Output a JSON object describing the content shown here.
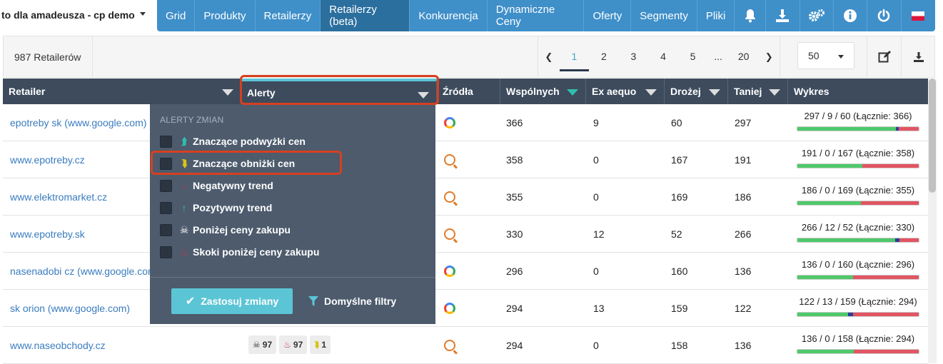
{
  "project": {
    "name": "to dla amadeusza - cp demo"
  },
  "nav": {
    "items": [
      "Grid",
      "Produkty",
      "Retailerzy",
      "Retailerzy (beta)",
      "Konkurencja",
      "Dynamiczne Ceny",
      "Oferty",
      "Segmenty",
      "Pliki"
    ],
    "active": "Retailerzy (beta)"
  },
  "toolbar": {
    "count_label": "987 Retailerów",
    "pages": [
      "1",
      "2",
      "3",
      "4",
      "5",
      "...",
      "20"
    ],
    "current_page": "1",
    "per_page": "50"
  },
  "table": {
    "headers": {
      "retailer": "Retailer",
      "alerty": "Alerty",
      "zrodla": "Źródła",
      "wspolnych": "Wspólnych",
      "ex_aequo": "Ex aequo",
      "drozej": "Drożej",
      "taniej": "Taniej",
      "wykres": "Wykres"
    },
    "rows": [
      {
        "retailer": "epotreby sk (www.google.com)",
        "source": "google",
        "wspolnych": "366",
        "ex_aequo": "9",
        "drozej": "60",
        "taniej": "297",
        "chart_label": "297 / 9 / 60 (Łącznie: 366)",
        "g": 297,
        "b": 9,
        "r": 60
      },
      {
        "retailer": "www.epotreby.cz",
        "source": "ceneo",
        "wspolnych": "358",
        "ex_aequo": "0",
        "drozej": "167",
        "taniej": "191",
        "chart_label": "191 / 0 / 167 (Łącznie: 358)",
        "g": 191,
        "b": 0,
        "r": 167
      },
      {
        "retailer": "www.elektromarket.cz",
        "source": "ceneo",
        "wspolnych": "355",
        "ex_aequo": "0",
        "drozej": "169",
        "taniej": "186",
        "chart_label": "186 / 0 / 169 (Łącznie: 355)",
        "g": 186,
        "b": 0,
        "r": 169
      },
      {
        "retailer": "www.epotreby.sk",
        "source": "ceneo",
        "wspolnych": "330",
        "ex_aequo": "12",
        "drozej": "52",
        "taniej": "266",
        "chart_label": "266 / 12 / 52 (Łącznie: 330)",
        "g": 266,
        "b": 12,
        "r": 52
      },
      {
        "retailer": "nasenadobi cz (www.google.com)",
        "source": "google",
        "wspolnych": "296",
        "ex_aequo": "0",
        "drozej": "160",
        "taniej": "136",
        "chart_label": "136 / 0 / 160 (Łącznie: 296)",
        "g": 136,
        "b": 0,
        "r": 160
      },
      {
        "retailer": "sk orion (www.google.com)",
        "source": "google",
        "wspolnych": "294",
        "ex_aequo": "13",
        "drozej": "159",
        "taniej": "122",
        "chart_label": "122 / 13 / 159 (Łącznie: 294)",
        "g": 122,
        "b": 13,
        "r": 159
      },
      {
        "retailer": "www.naseobchody.cz",
        "source": "ceneo",
        "wspolnych": "294",
        "ex_aequo": "0",
        "drozej": "158",
        "taniej": "136",
        "chart_label": "136 / 0 / 158 (Łącznie: 294)",
        "g": 136,
        "b": 0,
        "r": 158,
        "badges": [
          "97",
          "97",
          "1"
        ]
      }
    ]
  },
  "dropdown": {
    "header": "ALERTY ZMIAN",
    "options": [
      {
        "label": "Znaczące podwyżki cen",
        "icon": "trend-up-icon",
        "symbol": "⮭",
        "color": "#2fbfae"
      },
      {
        "label": "Znaczące obniżki cen",
        "icon": "trend-down-icon",
        "symbol": "⮯",
        "color": "#d6c21a"
      },
      {
        "label": "Negatywny trend",
        "icon": "arrow-down-icon",
        "symbol": "↓",
        "color": "#c8324a"
      },
      {
        "label": "Pozytywny trend",
        "icon": "arrow-up-icon",
        "symbol": "↑",
        "color": "#2fbfae"
      },
      {
        "label": "Poniżej ceny zakupu",
        "icon": "skull-icon",
        "symbol": "☠",
        "color": "#ffffff"
      },
      {
        "label": "Skoki poniżej ceny zakupu",
        "icon": "fire-icon",
        "symbol": "♨",
        "color": "#c8324a"
      }
    ],
    "apply_label": "Zastosuj zmiany",
    "defaults_label": "Domyślne filtry"
  },
  "colors": {
    "nav": "#3f8fc9",
    "header": "#3d4b5d",
    "highlight": "#d7401f",
    "green": "#4fc96a",
    "blue": "#2d3e9a",
    "red": "#e25563"
  }
}
